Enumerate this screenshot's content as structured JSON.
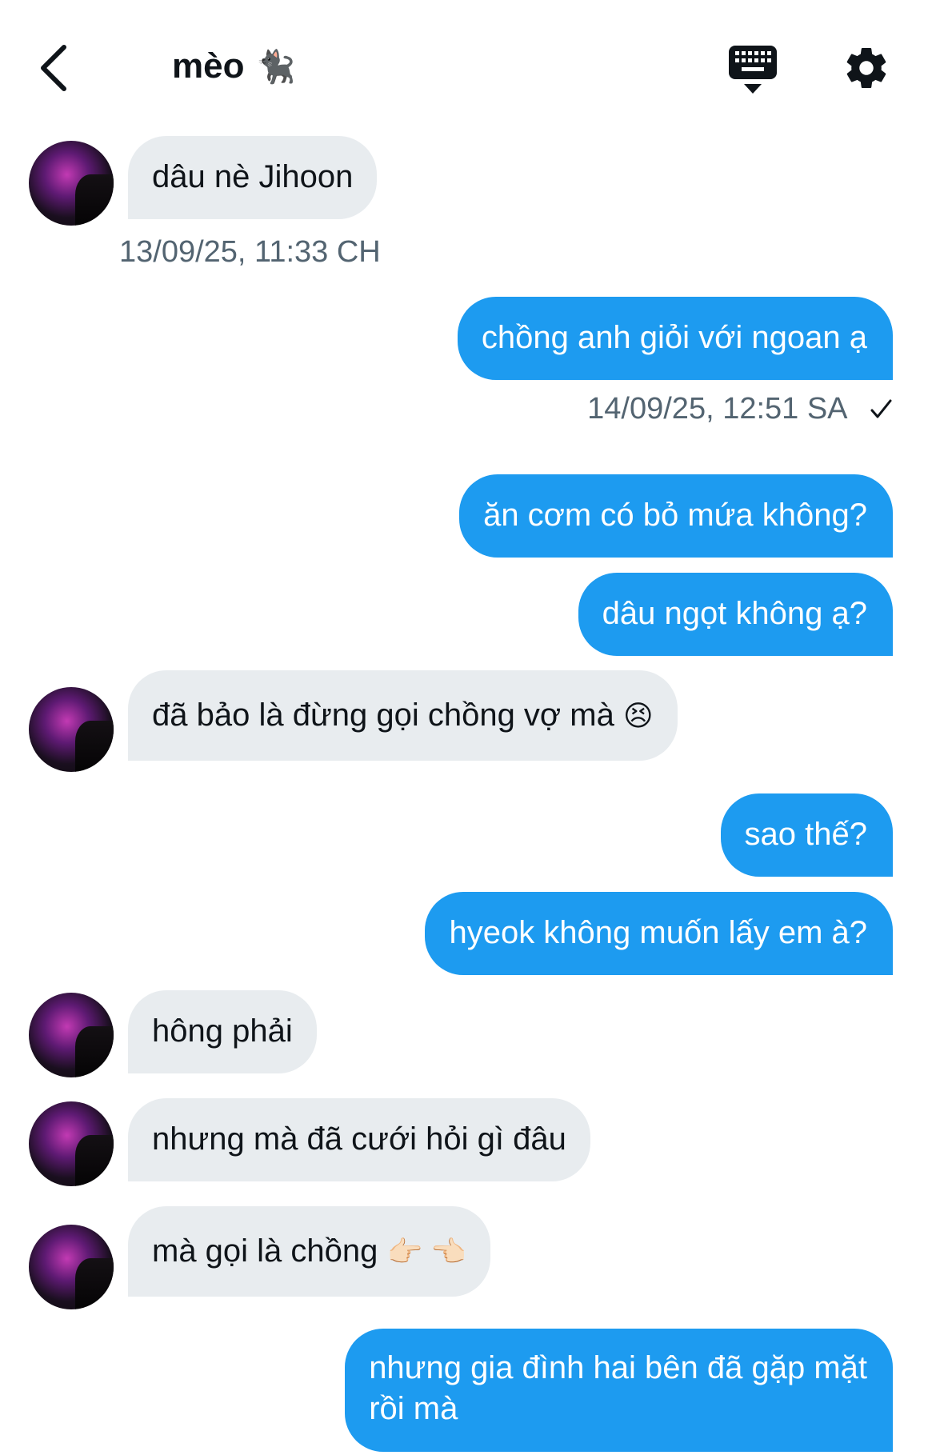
{
  "header": {
    "title": "mèo",
    "title_emoji": "🐈‍⬛",
    "back_icon": "chevron-left-icon",
    "keyboard_icon": "keyboard-icon",
    "settings_icon": "gear-icon"
  },
  "colors": {
    "outgoing_bubble": "#1d9bf0",
    "incoming_bubble": "#e8ecef",
    "timestamp": "#536471"
  },
  "messages": [
    {
      "sender": "them",
      "text": "dâu nè Jihoon",
      "timestamp": "13/09/25, 11:33 CH"
    },
    {
      "sender": "me",
      "text": "chồng anh giỏi với ngoan ạ",
      "timestamp": "14/09/25, 12:51 SA",
      "status": "✓"
    },
    {
      "sender": "me",
      "text": "ăn cơm có bỏ mứa không?"
    },
    {
      "sender": "me",
      "text": "dâu ngọt không ạ?"
    },
    {
      "sender": "them",
      "text": "đã bảo là đừng gọi chồng vợ mà",
      "emoji": "😣"
    },
    {
      "sender": "me",
      "text": "sao thế?"
    },
    {
      "sender": "me",
      "text": "hyeok không muốn lấy em à?"
    },
    {
      "sender": "them",
      "text": "hông phải"
    },
    {
      "sender": "them",
      "text": "nhưng mà đã cưới hỏi gì đâu"
    },
    {
      "sender": "them",
      "text": "mà gọi là chồng",
      "emoji": "👉🏻 👈🏻"
    },
    {
      "sender": "me",
      "text": "nhưng gia đình hai bên đã gặp mặt",
      "text_line2": "rồi mà"
    }
  ]
}
